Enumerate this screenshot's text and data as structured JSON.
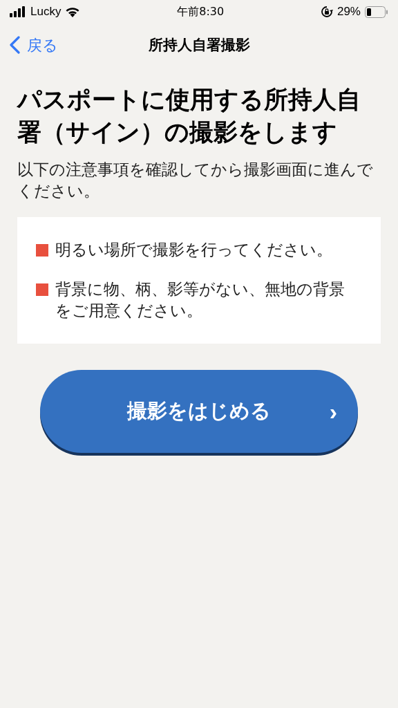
{
  "status_bar": {
    "carrier": "Lucky",
    "time": "午前8:30",
    "battery": "29%"
  },
  "nav": {
    "back": "戻る",
    "title": "所持人自署撮影"
  },
  "heading": "パスポートに使用する所持人自署（サイン）の撮影をします",
  "intro": "以下の注意事項を確認してから撮影画面に進んでください。",
  "notes": [
    {
      "text": "明るい場所で撮影を行ってください。"
    },
    {
      "text": "背景に物、柄、影等がない、無地の背景をご用意ください。"
    }
  ],
  "start_button": {
    "label": "撮影をはじめる",
    "chevron": "›"
  }
}
